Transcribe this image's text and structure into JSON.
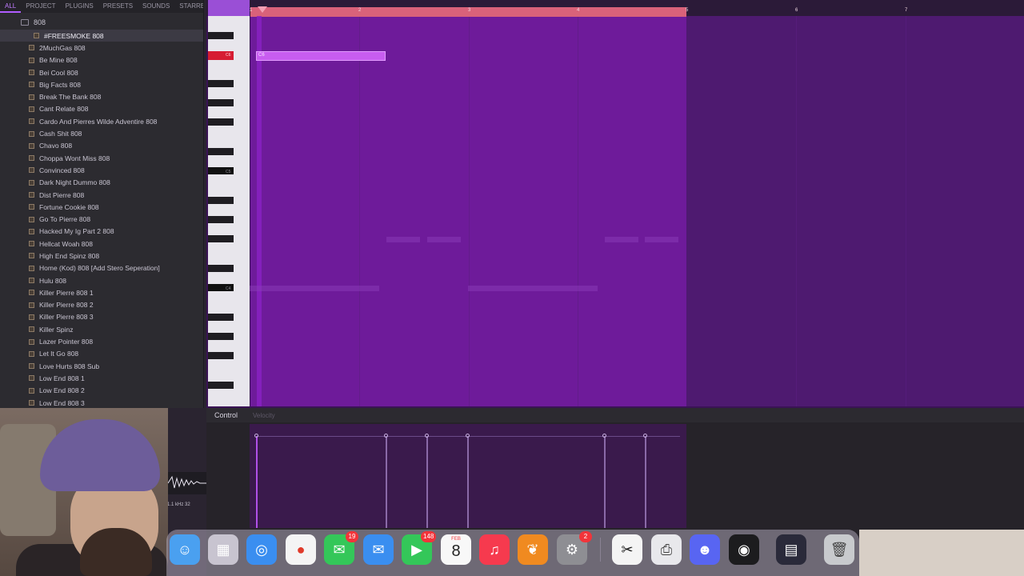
{
  "browser": {
    "tabs": [
      "ALL",
      "PROJECT",
      "PLUGINS",
      "PRESETS",
      "SOUNDS",
      "STARRED"
    ],
    "folder": "808",
    "items": [
      "#FREESMOKE 808",
      "2MuchGas 808",
      "Be Mine 808",
      "Bei Cool 808",
      "Big Facts 808",
      "Break The Bank 808",
      "Cant Relate 808",
      "Cardo And Pierres Wilde Adventire 808",
      "Cash Shit 808",
      "Chavo 808",
      "Choppa Wont Miss 808",
      "Convinced 808",
      "Dark Night Dummo 808",
      "Dist Pierre 808",
      "Fortune Cookie 808",
      "Go To Pierre 808",
      "Hacked My Ig Part 2 808",
      "Hellcat Woah 808",
      "High End Spinz 808",
      "Home (Kod) 808 [Add Stero Seperation]",
      "Hulu 808",
      "Killer Pierre 808 1",
      "Killer Pierre 808 2",
      "Killer Pierre 808 3",
      "Killer Spinz",
      "Lazer Pointer 808",
      "Let It Go 808",
      "Love Hurts 808 Sub",
      "Low End 808 1",
      "Low End 808 2",
      "Low End 808 3"
    ]
  },
  "timeline": {
    "ticks": [
      "1",
      "2",
      "3",
      "4",
      "5",
      "6",
      "7"
    ]
  },
  "keys": {
    "labels": [
      "C6",
      "C5",
      "C4"
    ]
  },
  "event_editor": {
    "control_label": "Control",
    "velocity_label": "Velocity"
  },
  "scope": {
    "readout": "1.1 kHz 32"
  },
  "dock": {
    "calendar_month": "FEB",
    "calendar_day": "8",
    "badges": {
      "messages": "19",
      "facetime": "148",
      "settings": "2"
    }
  }
}
